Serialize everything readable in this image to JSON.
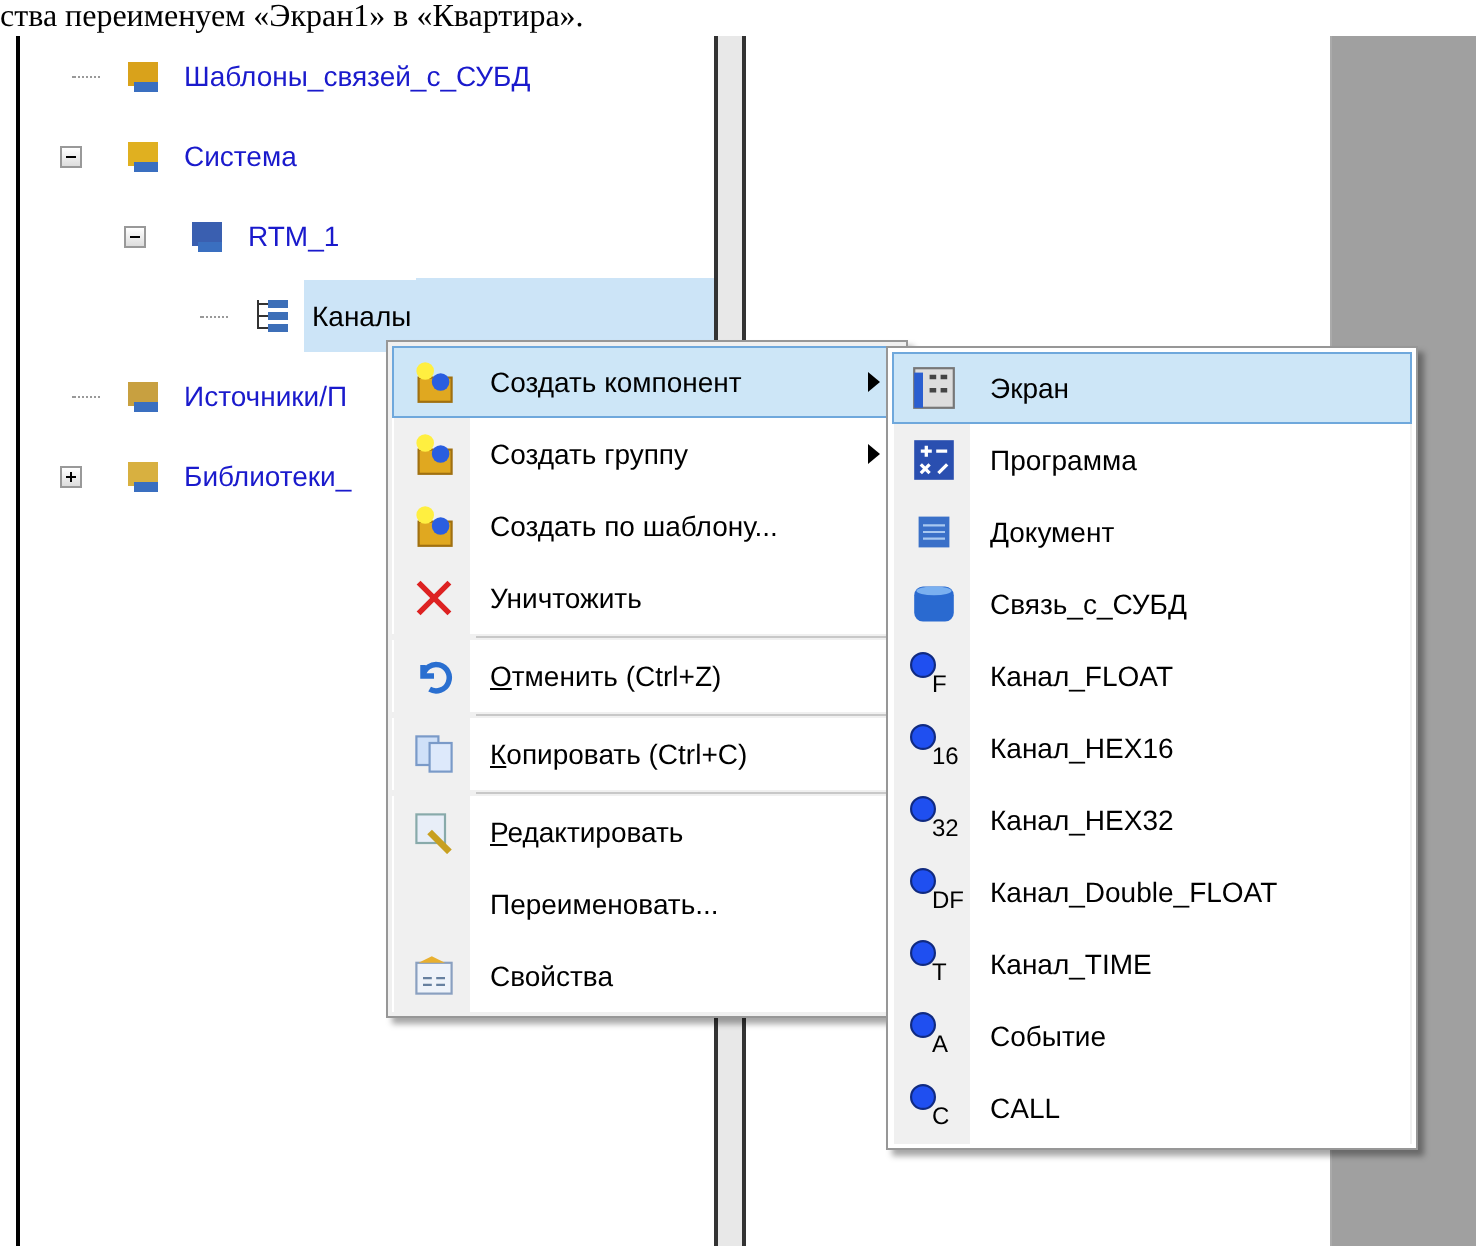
{
  "document_text": "ства переименуем «Экран1» в «Квартира».",
  "tree": [
    {
      "label": "Шаблоны_связей_с_СУБД",
      "selected": false
    },
    {
      "label": "Система",
      "expanded": true,
      "selected": false,
      "children": [
        {
          "label": "RTM_1",
          "expanded": true,
          "selected": false,
          "children": [
            {
              "label": "Каналы",
              "selected": true
            }
          ]
        }
      ]
    },
    {
      "label": "Источники/П",
      "selected": false
    },
    {
      "label": "Библиотеки_",
      "expanded": false,
      "selected": false
    }
  ],
  "context_menu": {
    "items": [
      {
        "label": "Создать компонент",
        "submenu": true,
        "selected": true
      },
      {
        "label": "Создать группу",
        "submenu": true,
        "selected": false
      },
      {
        "label": "Создать по шаблону...",
        "selected": false
      },
      {
        "label": "Уничтожить",
        "selected": false,
        "separator_after": true
      },
      {
        "label": "Отменить (Ctrl+Z)",
        "mnemonic": true,
        "selected": false,
        "separator_after": true
      },
      {
        "label": "Копировать (Ctrl+C)",
        "mnemonic": true,
        "selected": false,
        "separator_after": true
      },
      {
        "label": "Редактировать",
        "mnemonic": true,
        "selected": false
      },
      {
        "label": "Переименовать...",
        "selected": false
      },
      {
        "label": "Свойства",
        "selected": false
      }
    ]
  },
  "submenu": {
    "items": [
      {
        "label": "Экран",
        "selected": true
      },
      {
        "label": "Программа",
        "selected": false
      },
      {
        "label": "Документ",
        "selected": false
      },
      {
        "label": "Связь_с_СУБД",
        "selected": false
      },
      {
        "label": "Канал_FLOAT",
        "badge": "F",
        "selected": false
      },
      {
        "label": "Канал_HEX16",
        "badge": "16",
        "selected": false
      },
      {
        "label": "Канал_HEX32",
        "badge": "32",
        "selected": false
      },
      {
        "label": "Канал_Double_FLOAT",
        "badge": "DF",
        "selected": false
      },
      {
        "label": "Канал_TIME",
        "badge": "T",
        "selected": false
      },
      {
        "label": "Событие",
        "badge": "A",
        "selected": false
      },
      {
        "label": "CALL",
        "badge": "C",
        "selected": false
      }
    ]
  }
}
